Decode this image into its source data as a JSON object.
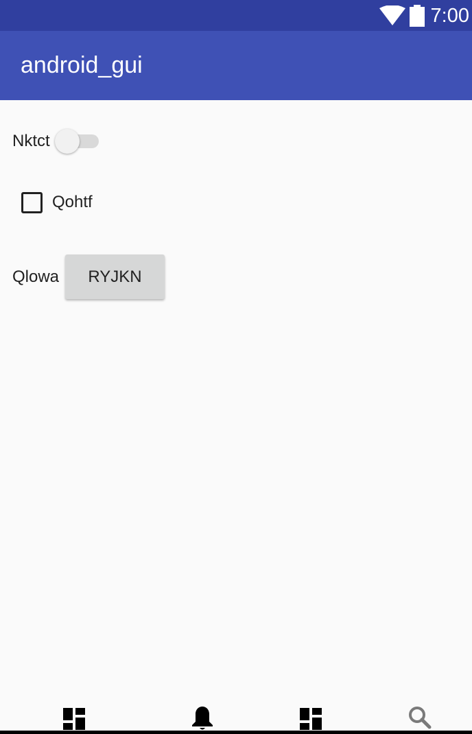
{
  "status_bar": {
    "time": "7:00",
    "icons": [
      "wifi-icon",
      "battery-icon"
    ],
    "background": "#303f9f"
  },
  "app_bar": {
    "title": "android_gui",
    "background": "#3f51b5"
  },
  "content": {
    "switch_row": {
      "label": "Nktct",
      "checked": false
    },
    "checkbox_row": {
      "label": "Qohtf",
      "checked": false
    },
    "button_row": {
      "label": "Qlowa",
      "button_label": "RYJKN"
    }
  },
  "bottom_nav": {
    "items": [
      {
        "icon": "dashboard-icon"
      },
      {
        "icon": "bell-icon"
      },
      {
        "icon": "dashboard-icon"
      },
      {
        "icon": "search-icon"
      }
    ]
  }
}
